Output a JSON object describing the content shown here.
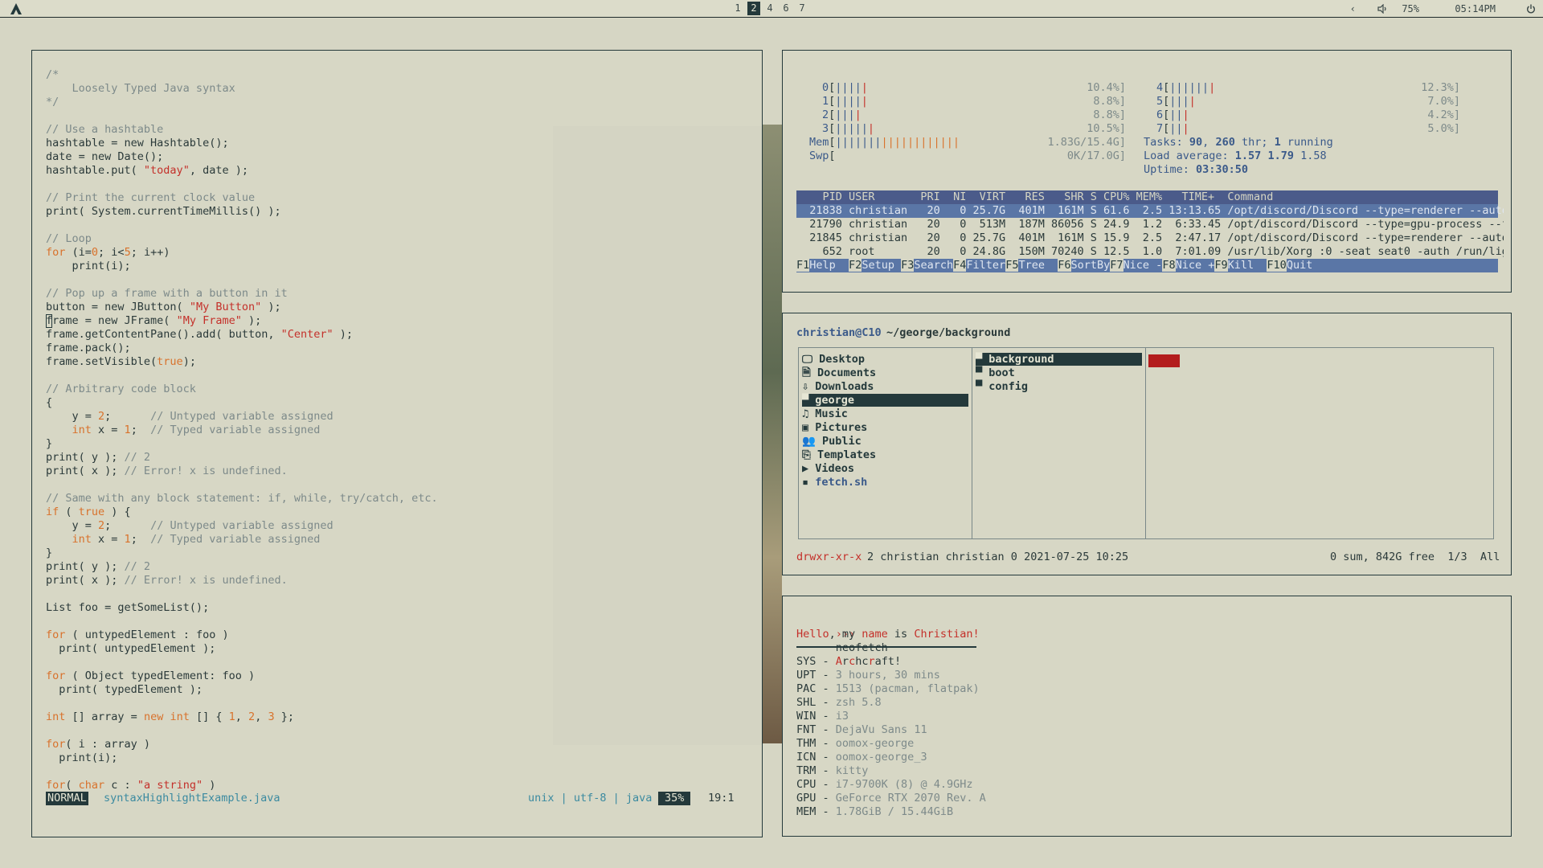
{
  "topbar": {
    "workspaces": [
      "1",
      "2",
      "4",
      "6",
      "7"
    ],
    "active_workspace": "2",
    "volume": "75%",
    "time": "05:14PM",
    "icons": [
      "archcraft-logo-icon",
      "chevron-left-icon",
      "volume-icon",
      "power-icon"
    ]
  },
  "editor": {
    "lines": [
      [
        [
          "/*",
          "cm"
        ]
      ],
      [
        [
          "    Loosely Typed Java syntax",
          "cm"
        ]
      ],
      [
        [
          "*/",
          "cm"
        ]
      ],
      [
        [
          "",
          ""
        ]
      ],
      [
        [
          "// Use a hashtable",
          "cm"
        ]
      ],
      [
        [
          "hashtable = new Hashtable();",
          ""
        ]
      ],
      [
        [
          "date = new Date();",
          ""
        ]
      ],
      [
        [
          "hashtable.put( ",
          ""
        ],
        [
          "\"today\"",
          "st"
        ],
        [
          ", date );",
          ""
        ]
      ],
      [
        [
          "",
          ""
        ]
      ],
      [
        [
          "// Print the current clock value",
          "cm"
        ]
      ],
      [
        [
          "print( System.currentTimeMillis() );",
          ""
        ]
      ],
      [
        [
          "",
          ""
        ]
      ],
      [
        [
          "// Loop",
          "cm"
        ]
      ],
      [
        [
          "for",
          "kw"
        ],
        [
          " (i=",
          ""
        ],
        [
          "0",
          "nm"
        ],
        [
          "; i<",
          ""
        ],
        [
          "5",
          "nm"
        ],
        [
          "; i++)",
          ""
        ]
      ],
      [
        [
          "    print(i);",
          ""
        ]
      ],
      [
        [
          "",
          ""
        ]
      ],
      [
        [
          "// Pop up a frame with a button in it",
          "cm"
        ]
      ],
      [
        [
          "button = new JButton( ",
          ""
        ],
        [
          "\"My Button\"",
          "st"
        ],
        [
          " );",
          ""
        ]
      ],
      [
        [
          "frame = new JFrame( ",
          ""
        ],
        [
          "\"My Frame\"",
          "st"
        ],
        [
          " );",
          ""
        ]
      ],
      [
        [
          "frame.getContentPane().add( button, ",
          ""
        ],
        [
          "\"Center\"",
          "st"
        ],
        [
          " );",
          ""
        ]
      ],
      [
        [
          "frame.pack();",
          ""
        ]
      ],
      [
        [
          "frame.setVisible(",
          ""
        ],
        [
          "true",
          "kw"
        ],
        [
          ");",
          ""
        ]
      ],
      [
        [
          "",
          ""
        ]
      ],
      [
        [
          "// Arbitrary code block",
          "cm"
        ]
      ],
      [
        [
          "{",
          ""
        ]
      ],
      [
        [
          "    y = ",
          ""
        ],
        [
          "2",
          "nm"
        ],
        [
          ";      ",
          ""
        ],
        [
          "// Untyped variable assigned",
          "cm"
        ]
      ],
      [
        [
          "    ",
          ""
        ],
        [
          "int",
          "kw"
        ],
        [
          " x = ",
          ""
        ],
        [
          "1",
          "nm"
        ],
        [
          ";  ",
          ""
        ],
        [
          "// Typed variable assigned",
          "cm"
        ]
      ],
      [
        [
          "}",
          ""
        ]
      ],
      [
        [
          "print( y ); ",
          ""
        ],
        [
          "// 2",
          "cm"
        ]
      ],
      [
        [
          "print( x ); ",
          ""
        ],
        [
          "// Error! x is undefined.",
          "cm"
        ]
      ],
      [
        [
          "",
          ""
        ]
      ],
      [
        [
          "// Same with any block statement: if, while, try/catch, etc.",
          "cm"
        ]
      ],
      [
        [
          "if",
          "kw"
        ],
        [
          " ( ",
          ""
        ],
        [
          "true",
          "kw"
        ],
        [
          " ) {",
          ""
        ]
      ],
      [
        [
          "    y = ",
          ""
        ],
        [
          "2",
          "nm"
        ],
        [
          ";      ",
          ""
        ],
        [
          "// Untyped variable assigned",
          "cm"
        ]
      ],
      [
        [
          "    ",
          ""
        ],
        [
          "int",
          "kw"
        ],
        [
          " x = ",
          ""
        ],
        [
          "1",
          "nm"
        ],
        [
          ";  ",
          ""
        ],
        [
          "// Typed variable assigned",
          "cm"
        ]
      ],
      [
        [
          "}",
          ""
        ]
      ],
      [
        [
          "print( y ); ",
          ""
        ],
        [
          "// 2",
          "cm"
        ]
      ],
      [
        [
          "print( x ); ",
          ""
        ],
        [
          "// Error! x is undefined.",
          "cm"
        ]
      ],
      [
        [
          "",
          ""
        ]
      ],
      [
        [
          "List foo = getSomeList();",
          ""
        ]
      ],
      [
        [
          "",
          ""
        ]
      ],
      [
        [
          "for",
          "kw"
        ],
        [
          " ( untypedElement : foo )",
          ""
        ]
      ],
      [
        [
          "  print( untypedElement );",
          ""
        ]
      ],
      [
        [
          "",
          ""
        ]
      ],
      [
        [
          "for",
          "kw"
        ],
        [
          " ( Object typedElement: foo )",
          ""
        ]
      ],
      [
        [
          "  print( typedElement );",
          ""
        ]
      ],
      [
        [
          "",
          ""
        ]
      ],
      [
        [
          "int",
          "kw"
        ],
        [
          " [] array = ",
          ""
        ],
        [
          "new",
          "kw"
        ],
        [
          " ",
          ""
        ],
        [
          "int",
          "kw"
        ],
        [
          " [] { ",
          ""
        ],
        [
          "1",
          "nm"
        ],
        [
          ", ",
          ""
        ],
        [
          "2",
          "nm"
        ],
        [
          ", ",
          ""
        ],
        [
          "3",
          "nm"
        ],
        [
          " };",
          ""
        ]
      ],
      [
        [
          "",
          ""
        ]
      ],
      [
        [
          "for",
          "kw"
        ],
        [
          "( i : array )",
          ""
        ]
      ],
      [
        [
          "  print(i);",
          ""
        ]
      ],
      [
        [
          "",
          ""
        ]
      ],
      [
        [
          "for",
          "kw"
        ],
        [
          "( ",
          ""
        ],
        [
          "char",
          "kw"
        ],
        [
          " c : ",
          ""
        ],
        [
          "\"a string\"",
          "st"
        ],
        [
          " )",
          ""
        ]
      ]
    ],
    "status": {
      "mode": "NORMAL",
      "filename": "syntaxHighlightExample.java",
      "info": "unix | utf-8 | java",
      "percent": "35%",
      "position": "19:1"
    }
  },
  "htop": {
    "cpus_left": [
      {
        "id": "0",
        "bars": [
          [
            "||||",
            "bar-g"
          ],
          [
            "|",
            "bar-r"
          ]
        ],
        "pct": "10.4%"
      },
      {
        "id": "1",
        "bars": [
          [
            "||||",
            "bar-g"
          ],
          [
            "|",
            "bar-r"
          ]
        ],
        "pct": "8.8%"
      },
      {
        "id": "2",
        "bars": [
          [
            "|||",
            "bar-g"
          ],
          [
            "|",
            "bar-r"
          ]
        ],
        "pct": "8.8%"
      },
      {
        "id": "3",
        "bars": [
          [
            "|||||",
            "bar-g"
          ],
          [
            "|",
            "bar-r"
          ]
        ],
        "pct": "10.5%"
      }
    ],
    "cpus_right": [
      {
        "id": "4",
        "bars": [
          [
            "||||||",
            "bar-g"
          ],
          [
            "|",
            "bar-r"
          ]
        ],
        "pct": "12.3%"
      },
      {
        "id": "5",
        "bars": [
          [
            "|||",
            "bar-g"
          ],
          [
            "|",
            "bar-r"
          ]
        ],
        "pct": "7.0%"
      },
      {
        "id": "6",
        "bars": [
          [
            "||",
            "bar-g"
          ],
          [
            "|",
            "bar-r"
          ]
        ],
        "pct": "4.2%"
      },
      {
        "id": "7",
        "bars": [
          [
            "||",
            "bar-g"
          ],
          [
            "|",
            "bar-r"
          ]
        ],
        "pct": "5.0%"
      }
    ],
    "mem": {
      "label": "Mem",
      "value": "1.83G/15.4G"
    },
    "swp": {
      "label": "Swp",
      "value": "0K/17.0G"
    },
    "tasks": {
      "label": "Tasks: ",
      "tasks": "90",
      "sep": ", ",
      "threads": "260",
      "thr": " thr; ",
      "running": "1",
      "run": " running"
    },
    "load": {
      "label": "Load average: ",
      "v1": "1.57",
      "v2": "1.79",
      "v3": "1.58"
    },
    "uptime": {
      "label": "Uptime: ",
      "value": "03:30:50"
    },
    "header": "    PID USER       PRI  NI  VIRT   RES   SHR S CPU% MEM%   TIME+  Command",
    "procs": [
      "  21838 christian   20   0 25.7G  401M  161M S 61.6  2.5 13:13.65 /opt/discord/Discord --type=renderer --autop",
      "  21790 christian   20   0  513M  187M 86056 S 24.9  1.2  6:33.45 /opt/discord/Discord --type=gpu-process --fi",
      "  21845 christian   20   0 25.7G  401M  161M S 15.9  2.5  2:47.17 /opt/discord/Discord --type=renderer --autop",
      "    652 root        20   0 24.8G  150M 70240 S 12.5  1.0  7:01.09 /usr/lib/Xorg :0 -seat seat0 -auth /run/ligh"
    ],
    "fkeys": [
      {
        "key": "F1",
        "label": "Help  "
      },
      {
        "key": "F2",
        "label": "Setup "
      },
      {
        "key": "F3",
        "label": "Search"
      },
      {
        "key": "F4",
        "label": "Filter"
      },
      {
        "key": "F5",
        "label": "Tree  "
      },
      {
        "key": "F6",
        "label": "SortBy"
      },
      {
        "key": "F7",
        "label": "Nice -"
      },
      {
        "key": "F8",
        "label": "Nice +"
      },
      {
        "key": "F9",
        "label": "Kill  "
      },
      {
        "key": "F10",
        "label": "Quit"
      }
    ]
  },
  "ranger": {
    "user": "christian@C10",
    "path": "~/george/background",
    "col1": [
      {
        "icon": "🖵",
        "name": "Desktop",
        "iname": "desktop-icon"
      },
      {
        "icon": "🗎",
        "name": "Documents",
        "iname": "documents-icon"
      },
      {
        "icon": "⇩",
        "name": "Downloads",
        "iname": "downloads-icon"
      },
      {
        "icon": "▀",
        "name": "george",
        "iname": "folder-icon",
        "selected": true
      },
      {
        "icon": "♫",
        "name": "Music",
        "iname": "music-icon"
      },
      {
        "icon": "▣",
        "name": "Pictures",
        "iname": "pictures-icon"
      },
      {
        "icon": "👥",
        "name": "Public",
        "iname": "public-icon"
      },
      {
        "icon": "⎘",
        "name": "Templates",
        "iname": "templates-icon"
      },
      {
        "icon": "▶",
        "name": "Videos",
        "iname": "videos-icon"
      },
      {
        "icon": "▪",
        "name": "fetch.sh",
        "iname": "script-icon",
        "script": true
      }
    ],
    "col2": [
      {
        "icon": "▀",
        "name": "background",
        "selected": true
      },
      {
        "icon": "▀",
        "name": "boot"
      },
      {
        "icon": "▀",
        "name": "config"
      }
    ],
    "statusbar": {
      "perms": "drwxr-xr-x",
      "meta": "2 christian christian 0 2021-07-25 10:25",
      "right": "0 sum, 842G free  1/3  All"
    }
  },
  "terminal": {
    "prompt": "›››",
    "command": "neofetch",
    "greet": [
      [
        "Hello",
        "red"
      ],
      [
        ", my ",
        ""
      ],
      [
        "name",
        "red"
      ],
      [
        " is ",
        ""
      ],
      [
        "Christian!",
        "red"
      ]
    ],
    "info": [
      {
        "k": "SYS",
        "v": "Archcraft!"
      },
      {
        "k": "UPT",
        "v": "3 hours, 30 mins"
      },
      {
        "k": "PAC",
        "v": "1513 (pacman, flatpak)"
      },
      {
        "k": "SHL",
        "v": "zsh 5.8"
      },
      {
        "k": "WIN",
        "v": "i3"
      },
      {
        "k": "FNT",
        "v": "DejaVu Sans 11"
      },
      {
        "k": "THM",
        "v": "oomox-george"
      },
      {
        "k": "ICN",
        "v": "oomox-george_3"
      },
      {
        "k": "TRM",
        "v": "kitty"
      },
      {
        "k": "CPU",
        "v": "i7-9700K (8) @ 4.9GHz"
      },
      {
        "k": "GPU",
        "v": "GeForce RTX 2070 Rev. A"
      },
      {
        "k": "MEM",
        "v": "1.78GiB / 15.44GiB"
      }
    ]
  }
}
